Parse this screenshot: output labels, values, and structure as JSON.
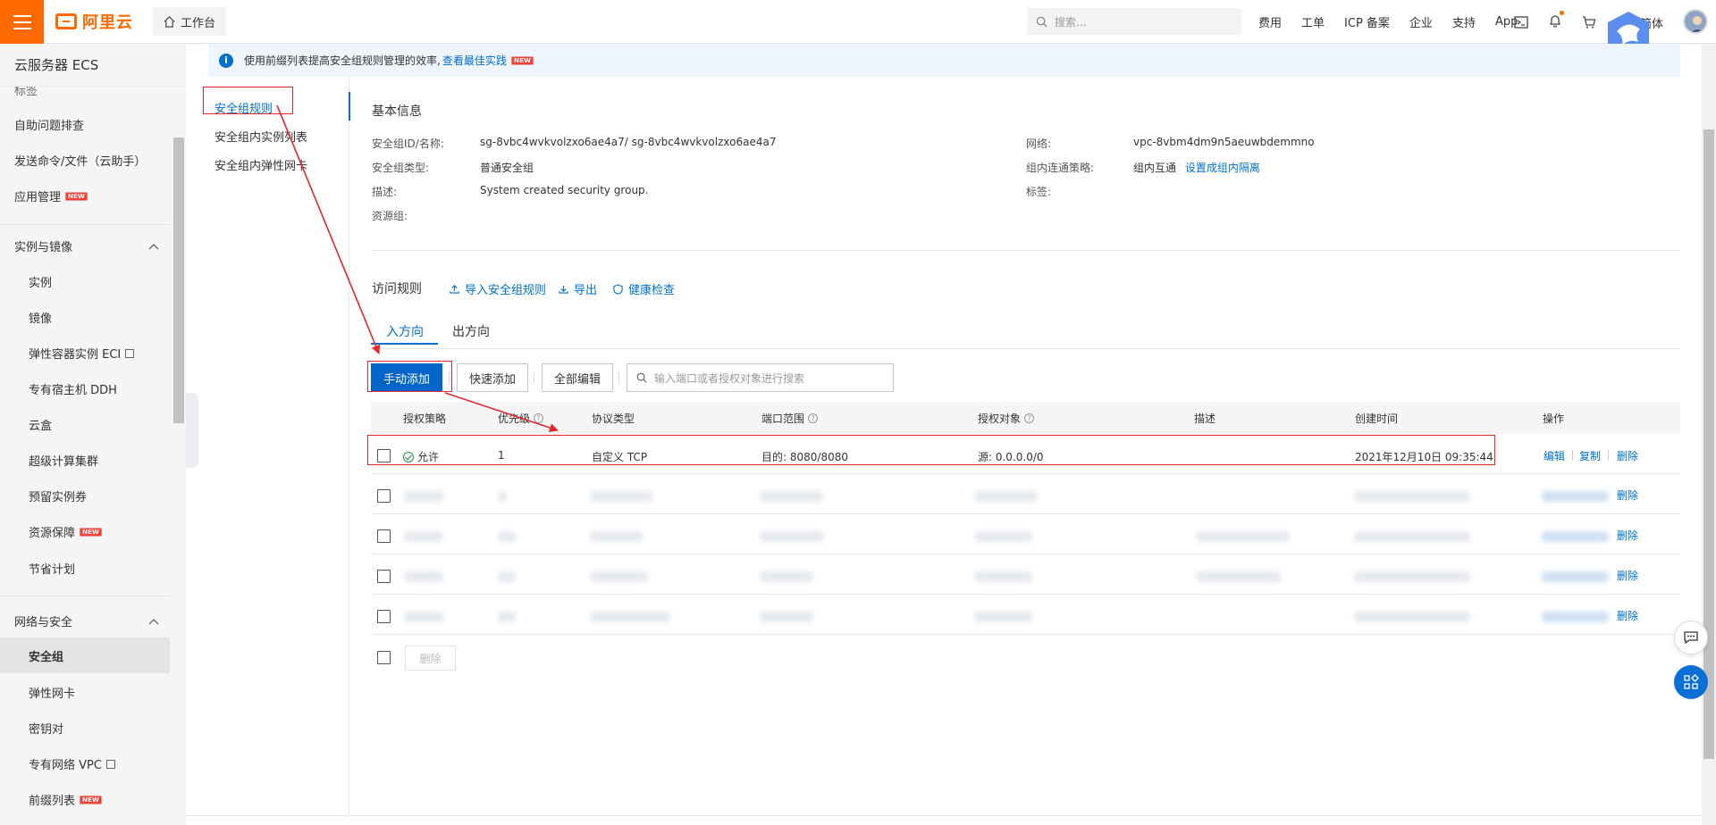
{
  "topbar": {
    "logo_text": "阿里云",
    "workbench": "工作台",
    "search_placeholder": "搜索...",
    "nav": [
      "费用",
      "工单",
      "ICP 备案",
      "企业",
      "支持",
      "App"
    ],
    "lang": "简体"
  },
  "sidebar": {
    "title": "云服务器 ECS",
    "items": {
      "tag": "标签",
      "self_check": "自助问题排查",
      "send_cmd": "发送命令/文件（云助手）",
      "app_mgmt": "应用管理",
      "group_instances": "实例与镜像",
      "instance": "实例",
      "image": "镜像",
      "eci": "弹性容器实例 ECI",
      "ddh": "专有宿主机 DDH",
      "cloud_box": "云盒",
      "super_cluster": "超级计算集群",
      "reserved": "预留实例券",
      "resource_guarantee": "资源保障",
      "savings_plan": "节省计划",
      "group_network": "网络与安全",
      "security_group": "安全组",
      "eni": "弹性网卡",
      "key_pair": "密钥对",
      "vpc": "专有网络 VPC",
      "prefix_list": "前缀列表"
    },
    "new_badge": "NEW"
  },
  "subnav": {
    "rules": "安全组规则",
    "instances": "安全组内实例列表",
    "eni": "安全组内弹性网卡"
  },
  "notice": {
    "text": "使用前缀列表提高安全组规则管理的效率,",
    "link": "查看最佳实践",
    "badge": "NEW"
  },
  "basic_info": {
    "title": "基本信息",
    "id_label": "安全组ID/名称:",
    "id_value": "sg-8vbc4wvkvolzxo6ae4a7/ sg-8vbc4wvkvolzxo6ae4a7",
    "type_label": "安全组类型:",
    "type_value": "普通安全组",
    "desc_label": "描述:",
    "desc_value": "System created security group.",
    "rg_label": "资源组:",
    "network_label": "网络:",
    "network_value": "vpc-8vbm4dm9n5aeuwbdemmno",
    "policy_label": "组内连通策略:",
    "policy_value": "组内互通",
    "policy_link": "设置成组内隔离",
    "tag_label": "标签:"
  },
  "access_rules": {
    "title": "访问规则",
    "import": "导入安全组规则",
    "export": "导出",
    "health": "健康检查",
    "tabs": [
      "入方向",
      "出方向"
    ]
  },
  "toolbar": {
    "manual_add": "手动添加",
    "quick_add": "快速添加",
    "edit_all": "全部编辑",
    "search_placeholder": "输入端口或者授权对象进行搜索",
    "delete": "删除"
  },
  "table": {
    "headers": [
      "授权策略",
      "优先级",
      "协议类型",
      "端口范围",
      "授权对象",
      "描述",
      "创建时间",
      "操作"
    ],
    "row1": {
      "policy": "允许",
      "priority": "1",
      "protocol": "自定义 TCP",
      "port": "目的: 8080/8080",
      "source": "源: 0.0.0.0/0",
      "desc": "",
      "created": "2021年12月10日 09:35:44"
    },
    "ops": [
      "编辑",
      "复制",
      "删除"
    ],
    "blurred_rows": 4
  },
  "colors": {
    "accent": "#ff6a00",
    "primary": "#0064c8",
    "link": "#0070cc",
    "annotation": "#e4262c"
  }
}
